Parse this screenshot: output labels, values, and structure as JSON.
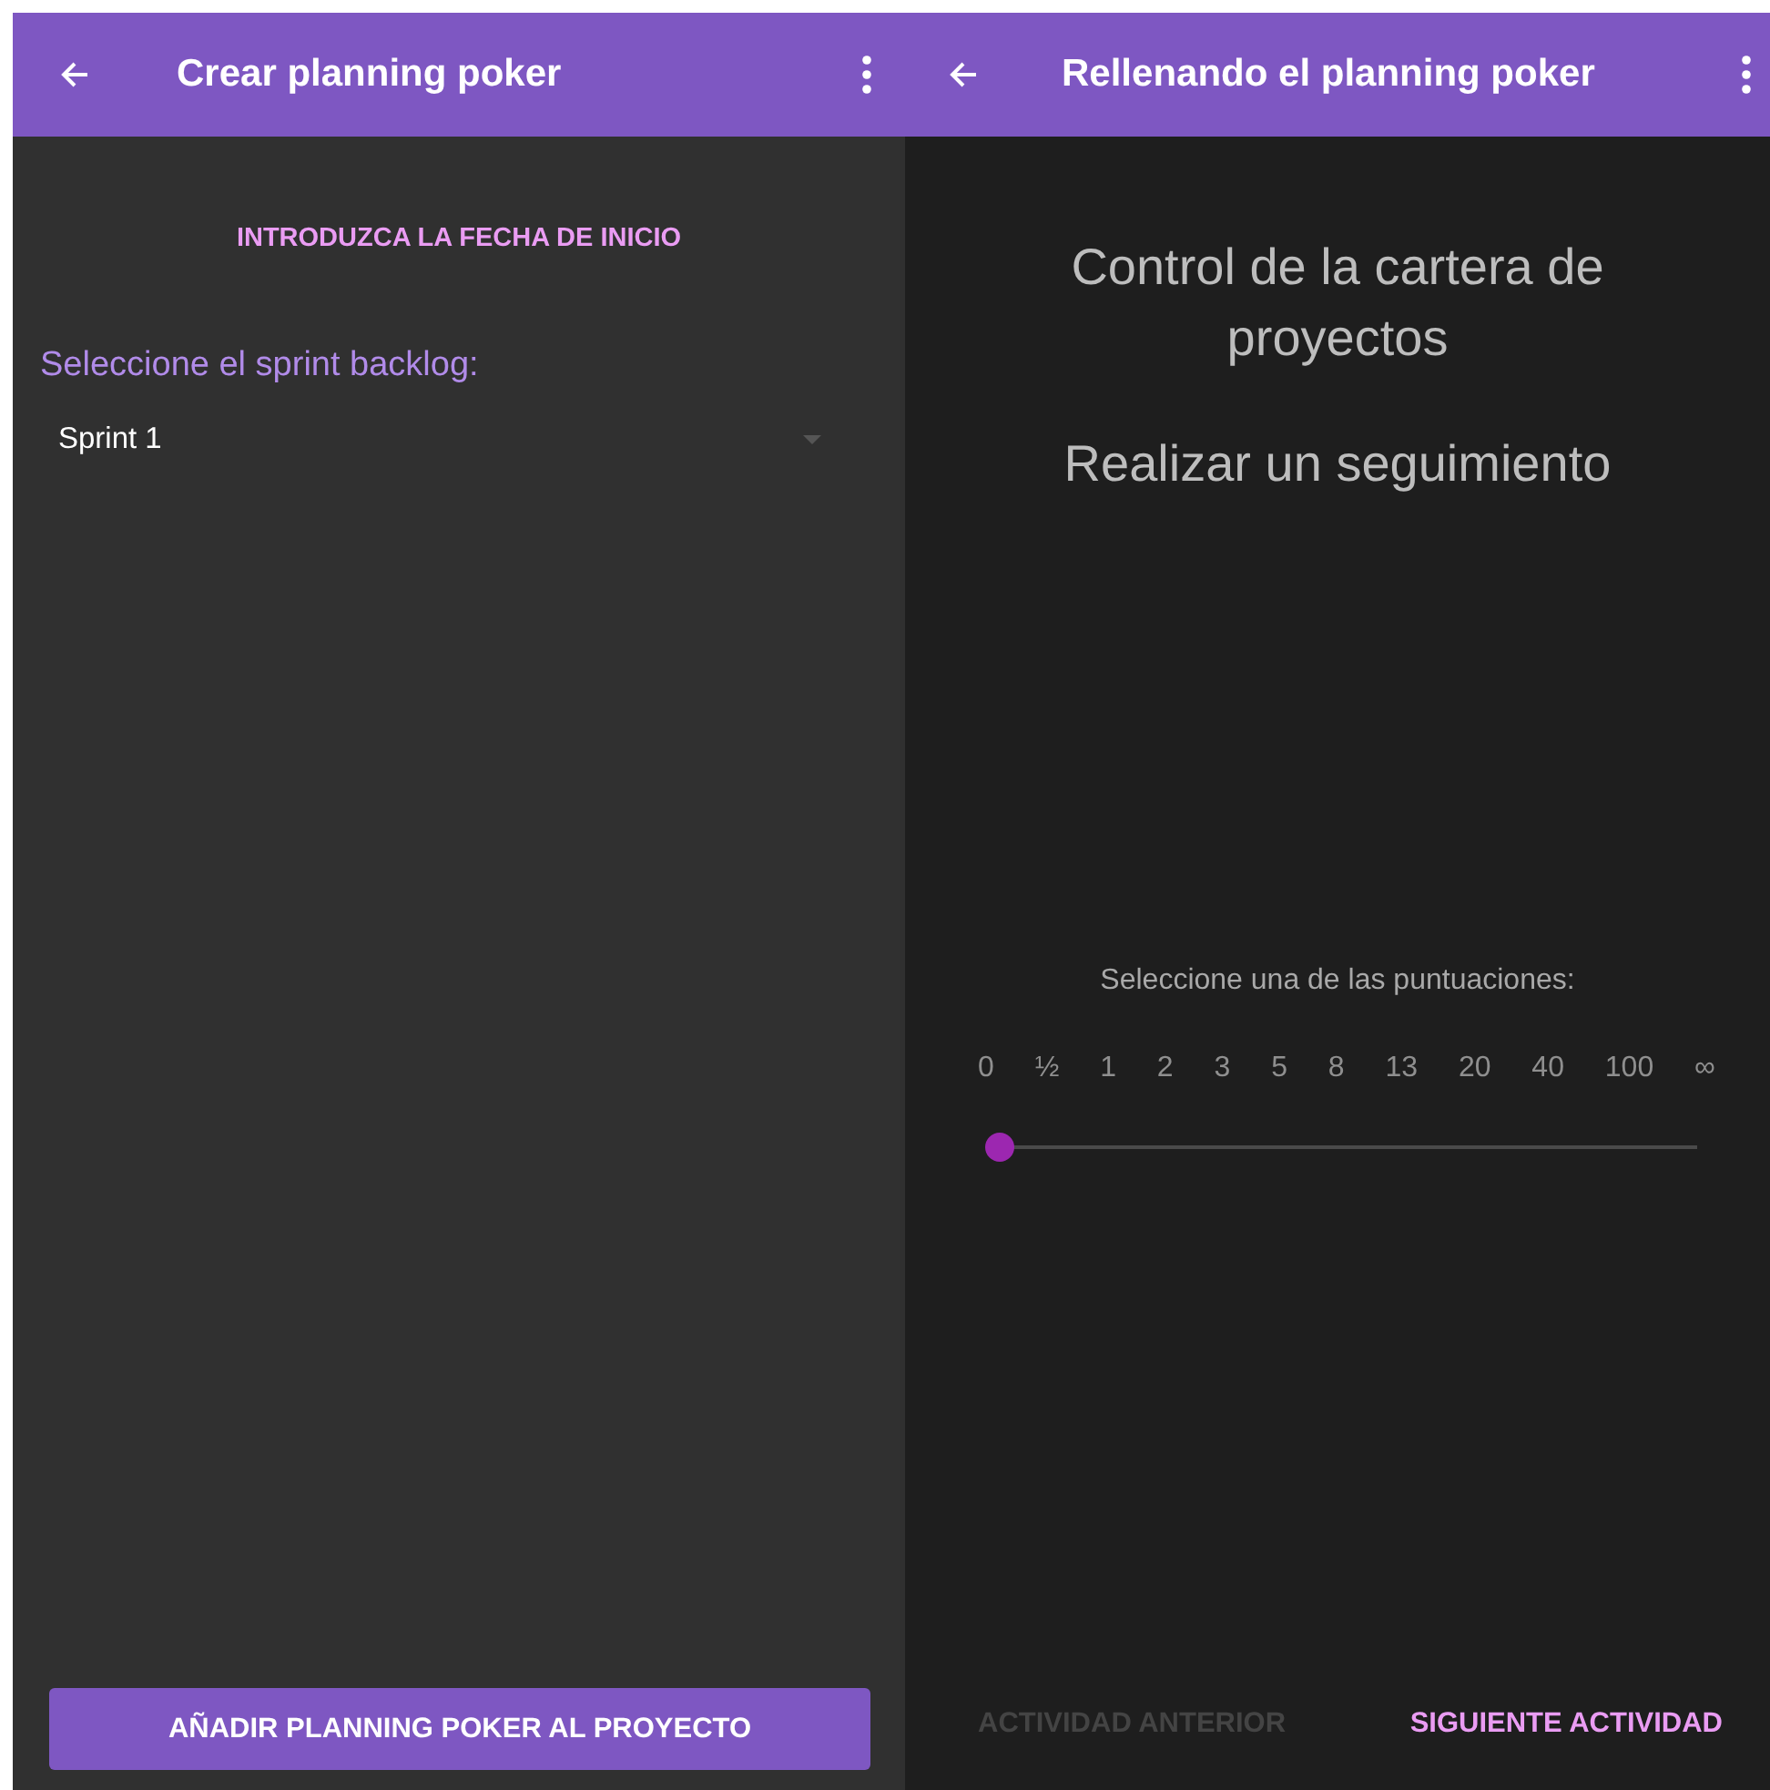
{
  "left_screen": {
    "app_bar": {
      "title": "Crear planning poker"
    },
    "date_button": "INTRODUZCA LA FECHA DE INICIO",
    "backlog_label": "Seleccione el sprint backlog:",
    "backlog_dropdown": {
      "value": "Sprint 1"
    },
    "add_button": "AÑADIR PLANNING POKER AL PROYECTO"
  },
  "right_screen": {
    "app_bar": {
      "title": "Rellenando el planning poker"
    },
    "activity_group": "Control de la cartera de proyectos",
    "activity": "Realizar un seguimiento",
    "score_label": "Seleccione una de las puntuaciones:",
    "scores": [
      "0",
      "½",
      "1",
      "2",
      "3",
      "5",
      "8",
      "13",
      "20",
      "40",
      "100",
      "∞"
    ],
    "score_slider": {
      "level": 0
    },
    "buttons": [
      {
        "label": "ACTIVIDAD ANTERIOR",
        "disabled": true
      },
      {
        "label": "SIGUIENTE ACTIVIDAD",
        "disabled": false
      }
    ]
  }
}
